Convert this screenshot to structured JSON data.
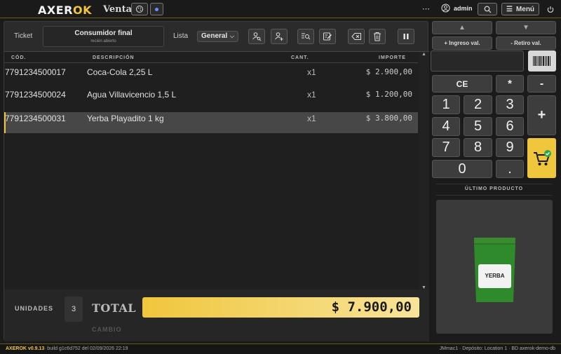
{
  "header": {
    "logo_main": "AXER",
    "logo_accent": "OK",
    "title": "Ventas",
    "more": "⋯",
    "user": "admin",
    "menu_label": "Menú"
  },
  "ticket": {
    "label": "Ticket",
    "customer_name": "Consumidor final",
    "customer_status": "recién abierto",
    "list_label": "Lista",
    "list_value": "General"
  },
  "table": {
    "columns": [
      "CÓD.",
      "DESCRIPCIÓN",
      "CANT.",
      "IMPORTE"
    ],
    "rows": [
      {
        "code": "7791234500017",
        "desc": "Coca-Cola 2,25 L",
        "qty": "x1",
        "amount": "$ 2.900,00"
      },
      {
        "code": "7791234500024",
        "desc": "Agua Villavicencio 1,5 L",
        "qty": "x1",
        "amount": "$ 1.200,00"
      },
      {
        "code": "7791234500031",
        "desc": "Yerba Playadito 1 kg",
        "qty": "x1",
        "amount": "$ 3.800,00"
      }
    ]
  },
  "summary": {
    "units_label": "UNIDADES",
    "units_value": "3",
    "total_label": "TOTAL",
    "total_value": "$ 7.900,00",
    "change_label": "CAMBIO"
  },
  "side": {
    "up": "▲",
    "down": "▼",
    "cash_in": "+ Ingreso val.",
    "cash_out": "- Retiro val.",
    "keys": {
      "ce": "CE",
      "mul": "*",
      "minus": "-",
      "plus": "+",
      "zero": "0",
      "dot": ".",
      "n1": "1",
      "n2": "2",
      "n3": "3",
      "n4": "4",
      "n5": "5",
      "n6": "6",
      "n7": "7",
      "n8": "8",
      "n9": "9"
    },
    "last_product_label": "ÚLTIMO PRODUCTO",
    "last_product_tag": "YERBA"
  },
  "footer": {
    "version": "AXEROK v0.9.13",
    "build": " · build g1c6d752 del 02/09/2026 22:19",
    "right": "JMmac1 · Depósito: Location 1 · BD axerok-demo-db"
  },
  "colors": {
    "accent": "#f0c63c",
    "background": "#1b1b1b",
    "panel": "#2b2b2b"
  }
}
